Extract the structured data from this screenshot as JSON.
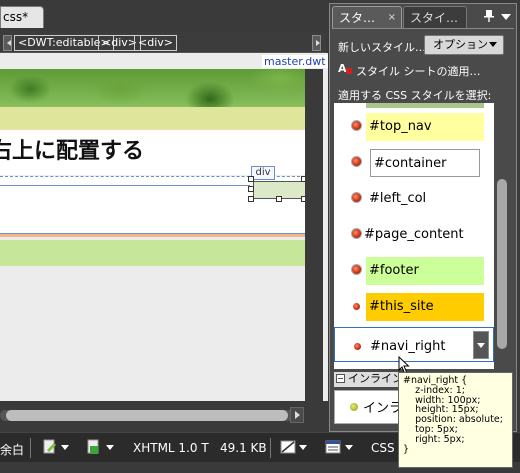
{
  "document": {
    "tab_label": "css*",
    "tags": [
      "<DWT:editable>",
      "<div>",
      "<div>"
    ],
    "master_label": "master.dwt",
    "heading": "右上に配置する",
    "div_label": "div"
  },
  "status_bar": {
    "margin_label": "余白",
    "doctype": "XHTML 1.0 T",
    "file_size": "49.1 KB",
    "css_label": "CSS"
  },
  "panel": {
    "tab_active": "スタ…",
    "tab_inactive": "スタイ…",
    "close_glyph": "×",
    "new_style_link": "新しいスタイル…",
    "options_button": "オプション",
    "attach_link": "スタイル シートの適用…",
    "apply_label": "適用する CSS スタイルを選択:",
    "styles": [
      {
        "name": "#top_nav"
      },
      {
        "name": "#container"
      },
      {
        "name": "#left_col"
      },
      {
        "name": "#page_content"
      },
      {
        "name": "#footer"
      },
      {
        "name": "#this_site"
      },
      {
        "name": "#navi_right"
      }
    ],
    "inline_header": "インライン",
    "inline_item": "インラ"
  },
  "tooltip": {
    "text": "#navi_right {\n    z-index: 1;\n    width: 100px;\n    height: 15px;\n    position: absolute;\n    top: 5px;\n    right: 5px;\n}"
  },
  "colors": {
    "top_nav_bg": "#ffffa0",
    "footer_bg": "#ccff99",
    "this_site_bg": "#ffcc00",
    "selection": "#3070c0"
  }
}
